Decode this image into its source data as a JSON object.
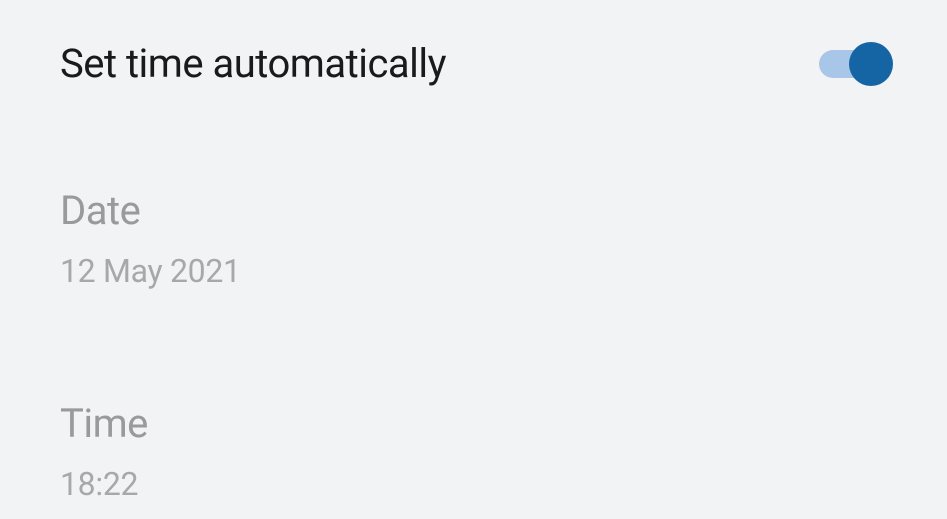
{
  "settings": {
    "auto_time": {
      "label": "Set time automatically",
      "enabled": true
    },
    "date": {
      "label": "Date",
      "value": "12 May 2021"
    },
    "time": {
      "label": "Time",
      "value": "18:22"
    }
  }
}
